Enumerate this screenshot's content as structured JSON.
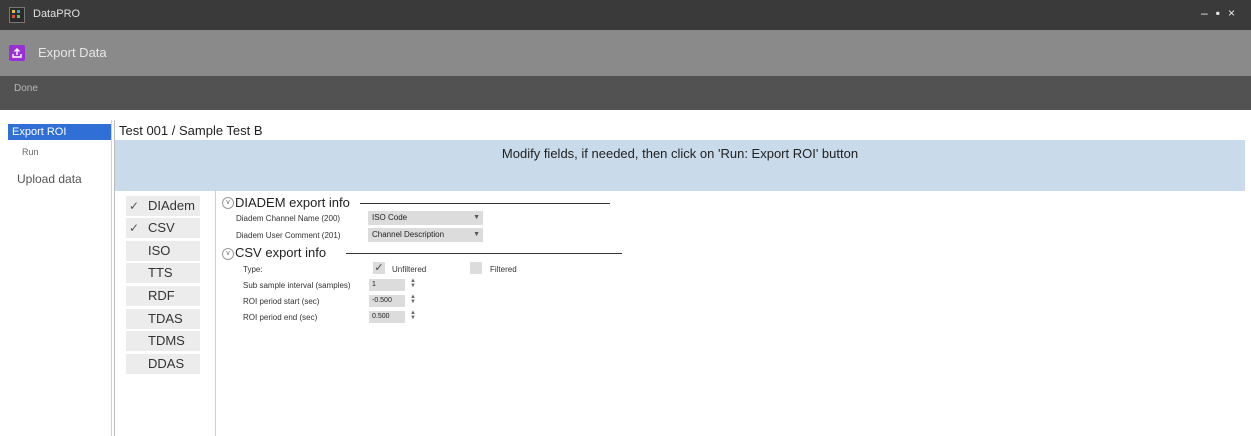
{
  "window": {
    "title": "DataPRO",
    "controls": [
      "–",
      "▪",
      "×"
    ]
  },
  "toolbar": {
    "title": "Export Data"
  },
  "actionbar": {
    "done_label": "Done"
  },
  "nav": {
    "items": [
      {
        "label": "Export ROI"
      },
      {
        "label": "Run"
      },
      {
        "label": "Upload data"
      }
    ]
  },
  "header": {
    "breadcrumb": "Test 001 / Sample Test B"
  },
  "banner": {
    "text": "Modify fields, if needed, then click on 'Run: Export ROI' button"
  },
  "formats": [
    {
      "label": "DIAdem",
      "checked": "✓"
    },
    {
      "label": "CSV",
      "checked": "✓"
    },
    {
      "label": "ISO",
      "checked": ""
    },
    {
      "label": "TTS",
      "checked": ""
    },
    {
      "label": "RDF",
      "checked": ""
    },
    {
      "label": "TDAS",
      "checked": ""
    },
    {
      "label": "TDMS",
      "checked": ""
    },
    {
      "label": "DDAS",
      "checked": ""
    }
  ],
  "diadem": {
    "title": "DIADEM export info",
    "channel_name_label": "Diadem Channel Name (200)",
    "channel_name_value": "ISO Code",
    "user_comment_label": "Diadem User Comment (201)",
    "user_comment_value": "Channel Description"
  },
  "csv": {
    "title": "CSV export info",
    "type_label": "Type:",
    "unfiltered_label": "Unfiltered",
    "unfiltered_checked": "✓",
    "filtered_label": "Filtered",
    "filtered_checked": "",
    "sub_sample_label": "Sub sample interval (samples)",
    "sub_sample_value": "1",
    "roi_start_label": "ROI period start (sec)",
    "roi_start_value": "-0.500",
    "roi_end_label": "ROI period end (sec)",
    "roi_end_value": "0.500"
  },
  "colors": {
    "accent_nav": "#2f6fd6",
    "export_icon": "#9a2fd6",
    "banner": "#c9daea"
  },
  "icons": {
    "app": "datapro-logo-icon",
    "export": "export-upload-icon"
  }
}
